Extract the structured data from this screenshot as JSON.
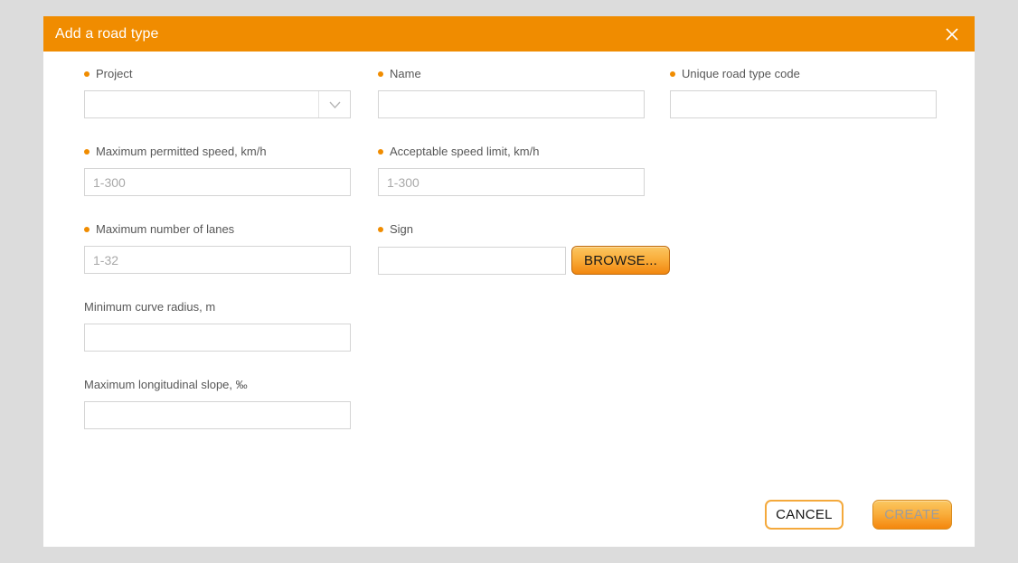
{
  "dialog": {
    "title": "Add a road type",
    "close_icon": "close-icon",
    "accent_color": "#f08c00",
    "backdrop_color": "#dcdcdc"
  },
  "fields": [
    {
      "label": "Project",
      "required": true,
      "control": "select",
      "value": "",
      "placeholder": "",
      "arrow_icon": "chevron-down-icon",
      "name": "project"
    },
    {
      "label": "Name",
      "required": true,
      "control": "text",
      "value": "",
      "placeholder": "",
      "name": "name"
    },
    {
      "label": "Unique road type code",
      "required": true,
      "control": "text",
      "value": "",
      "placeholder": "",
      "name": "unique-road-type-code"
    },
    {
      "label": "Maximum permitted speed, km/h",
      "required": true,
      "control": "text",
      "value": "",
      "placeholder": "1-300",
      "name": "maximum-permitted-speed"
    },
    {
      "label": "Acceptable speed limit, km/h",
      "required": true,
      "control": "text",
      "value": "",
      "placeholder": "1-300",
      "name": "acceptable-speed-limit"
    },
    {
      "label": "Maximum number of lanes",
      "required": true,
      "control": "text",
      "value": "",
      "placeholder": "1-32",
      "name": "maximum-number-of-lanes"
    },
    {
      "label": "Sign",
      "required": true,
      "control": "file",
      "value": "",
      "placeholder": "",
      "button_label": "BROWSE...",
      "name": "sign"
    },
    {
      "label": "Minimum curve radius, m",
      "required": false,
      "control": "text",
      "value": "",
      "placeholder": "",
      "name": "minimum-curve-radius"
    },
    {
      "label": "Maximum longitudinal slope, ‰",
      "required": false,
      "control": "text",
      "value": "",
      "placeholder": "",
      "name": "maximum-longitudinal-slope"
    }
  ],
  "footer": {
    "cancel_label": "CANCEL",
    "create_label": "CREATE",
    "create_disabled": true
  }
}
